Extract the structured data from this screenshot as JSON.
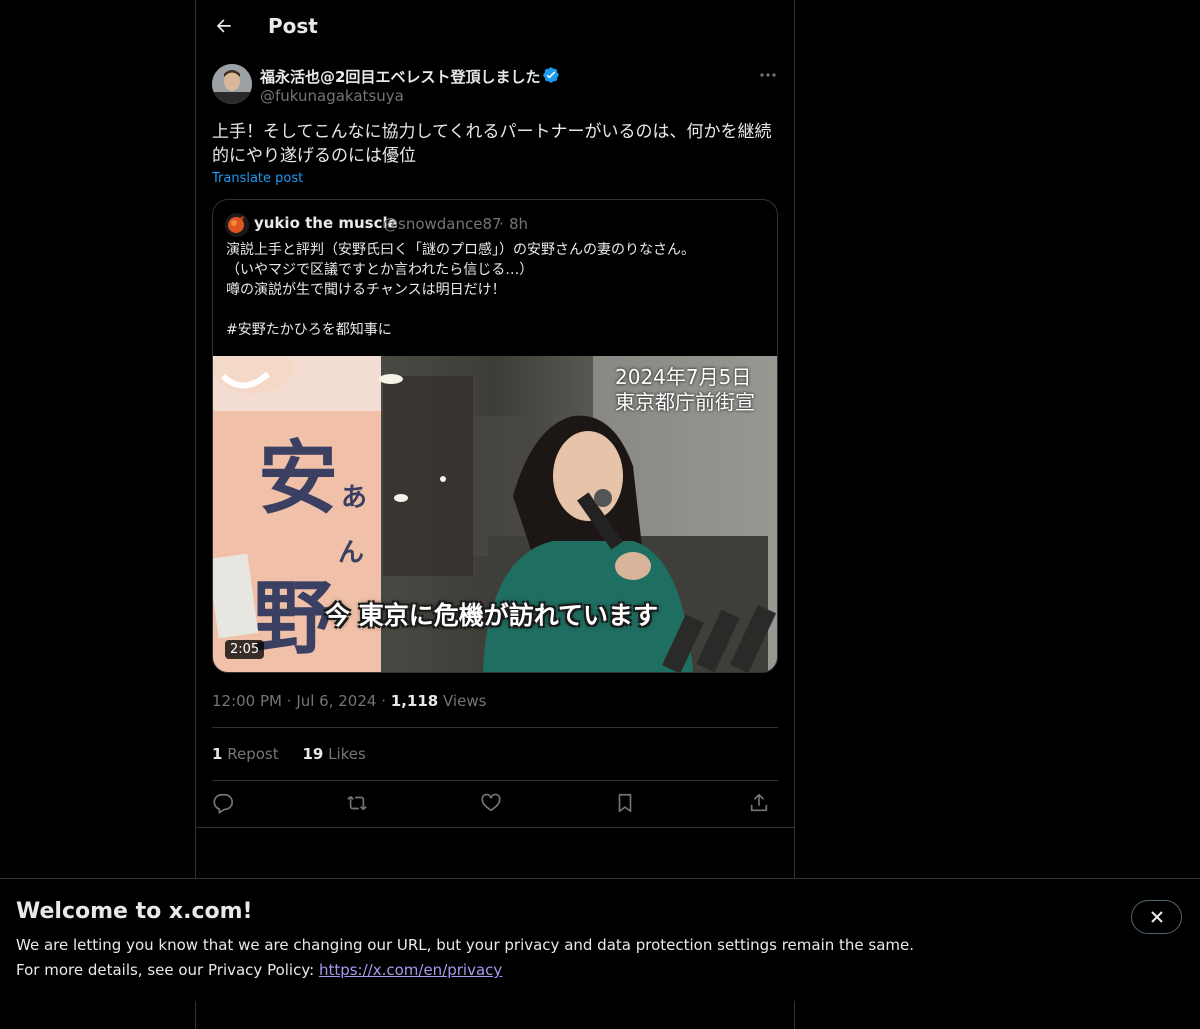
{
  "header": {
    "title": "Post"
  },
  "post": {
    "author_name": "福永活也@2回目エベレスト登頂しました",
    "author_handle": "@fukunagakatsuya",
    "text": "上手！そしてこんなに協力してくれるパートナーがいるのは、何かを継続的にやり遂げるのには優位",
    "translate_label": "Translate post",
    "time": "12:00 PM",
    "date": "Jul 6, 2024",
    "views_count": "1,118",
    "views_label": "Views",
    "reposts_count": "1",
    "reposts_label": "Repost",
    "likes_count": "19",
    "likes_label": "Likes"
  },
  "quote": {
    "name": "yukio the muscle",
    "handle": "@snowdance87",
    "time": "8h",
    "lines": [
      "演説上手と評判（安野氏曰く「謎のプロ感」）の安野さんの妻のりなさん。",
      "（いやマジで区議ですとか言われたら信じる…）",
      "噂の演説が生で聞けるチャンスは明日だけ！",
      "",
      "#安野たかひろを都知事に"
    ],
    "video": {
      "date_line1": "2024年7月5日",
      "date_line2": "東京都庁前街宣",
      "caption": "今 東京に危機が訪れています",
      "duration": "2:05"
    }
  },
  "banner": {
    "title": "Welcome to x.com!",
    "line1": "We are letting you know that we are changing our URL, but your privacy and data protection settings remain the same.",
    "line2_prefix": "For more details, see our Privacy Policy: ",
    "link": "https://x.com/en/privacy"
  },
  "colors": {
    "accent": "#1d9bf0",
    "text_secondary": "#71767b",
    "border": "#2f3336",
    "link_visited": "#a39bf0"
  },
  "icons": {
    "back": "arrow-left-icon",
    "more": "more-horizontal-icon",
    "verified": "verified-badge-icon",
    "reply": "reply-icon",
    "repost": "repost-icon",
    "like": "heart-icon",
    "bookmark": "bookmark-icon",
    "share": "share-icon",
    "close": "close-icon"
  }
}
